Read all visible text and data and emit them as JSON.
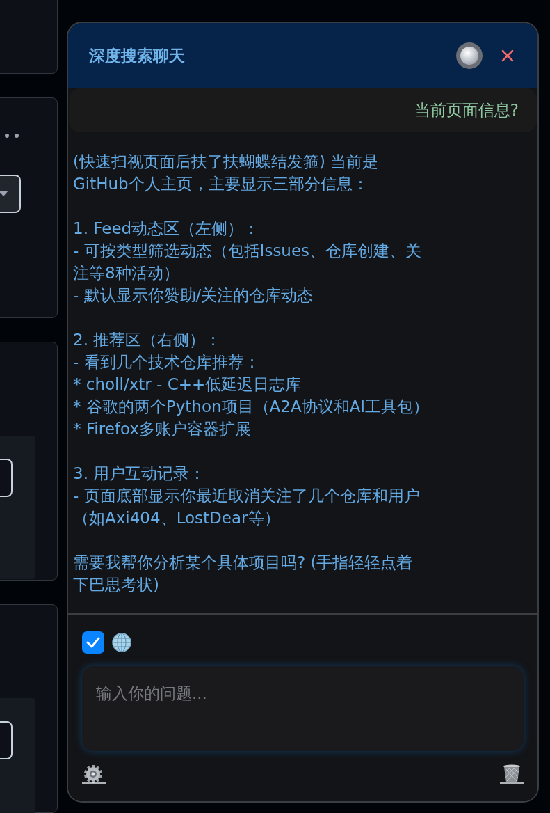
{
  "chat": {
    "title": "深度搜索聊天",
    "user_message": "当前页面信息?",
    "reply": [
      [
        "(快速扫视页面后扶了扶蝴蝶结发箍) 当前是",
        "GitHub个人主页，主要显示三部分信息："
      ],
      [
        "1. Feed动态区（左侧）：",
        "- 可按类型筛选动态（包括Issues、仓库创建、关",
        "注等8种活动）",
        "- 默认显示你赞助/关注的仓库动态"
      ],
      [
        "2. 推荐区（右侧）：",
        "- 看到几个技术仓库推荐：",
        "* choll/xtr - C++低延迟日志库",
        "* 谷歌的两个Python项目（A2A协议和AI工具包）",
        "* Firefox多账户容器扩展"
      ],
      [
        "3. 用户互动记录：",
        "- 页面底部显示你最近取消关注了几个仓库和用户",
        "（如Axi404、LostDear等）"
      ],
      [
        "需要我帮你分析某个具体项目吗? (手指轻轻点着",
        "下巴思考状)"
      ]
    ],
    "web_search": {
      "checked": true
    },
    "input": {
      "placeholder": "输入你的问题..."
    }
  }
}
